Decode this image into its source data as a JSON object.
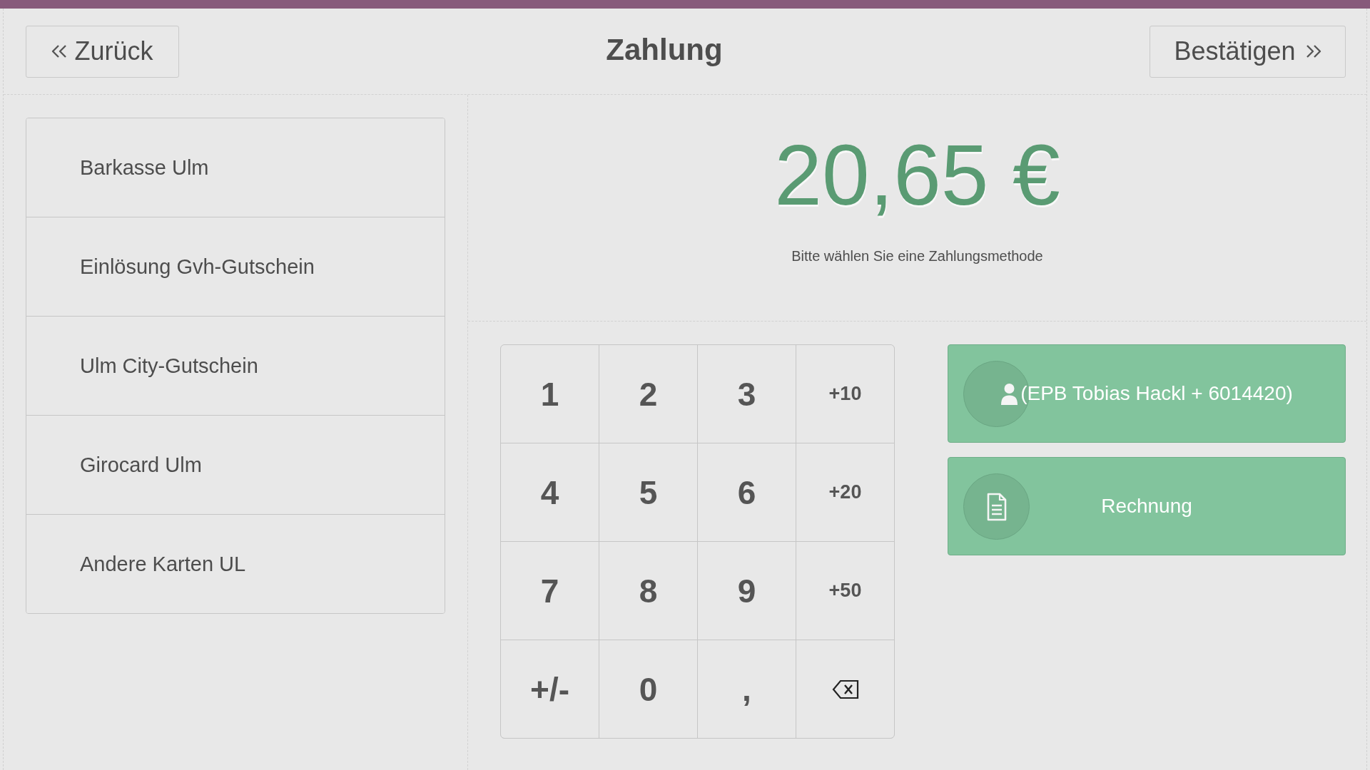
{
  "header": {
    "back_label": "Zurück",
    "title": "Zahlung",
    "confirm_label": "Bestätigen"
  },
  "payment_methods": [
    {
      "label": "Barkasse Ulm"
    },
    {
      "label": "Einlösung Gvh-Gutschein"
    },
    {
      "label": "Ulm City-Gutschein"
    },
    {
      "label": "Girocard Ulm"
    },
    {
      "label": "Andere Karten UL"
    }
  ],
  "summary": {
    "amount": "20,65 €",
    "hint": "Bitte wählen Sie eine Zahlungsmethode"
  },
  "keypad": [
    {
      "kind": "digit",
      "label": "1"
    },
    {
      "kind": "digit",
      "label": "2"
    },
    {
      "kind": "digit",
      "label": "3"
    },
    {
      "kind": "increment",
      "label": "+10"
    },
    {
      "kind": "digit",
      "label": "4"
    },
    {
      "kind": "digit",
      "label": "5"
    },
    {
      "kind": "digit",
      "label": "6"
    },
    {
      "kind": "increment",
      "label": "+20"
    },
    {
      "kind": "digit",
      "label": "7"
    },
    {
      "kind": "digit",
      "label": "8"
    },
    {
      "kind": "digit",
      "label": "9"
    },
    {
      "kind": "increment",
      "label": "+50"
    },
    {
      "kind": "sign",
      "label": "+/-"
    },
    {
      "kind": "digit",
      "label": "0"
    },
    {
      "kind": "decimal",
      "label": ","
    },
    {
      "kind": "backspace"
    }
  ],
  "actions": [
    {
      "kind": "customer",
      "label": "(EPB Tobias Hackl + 6014420)"
    },
    {
      "kind": "invoice",
      "label": "Rechnung"
    }
  ]
}
